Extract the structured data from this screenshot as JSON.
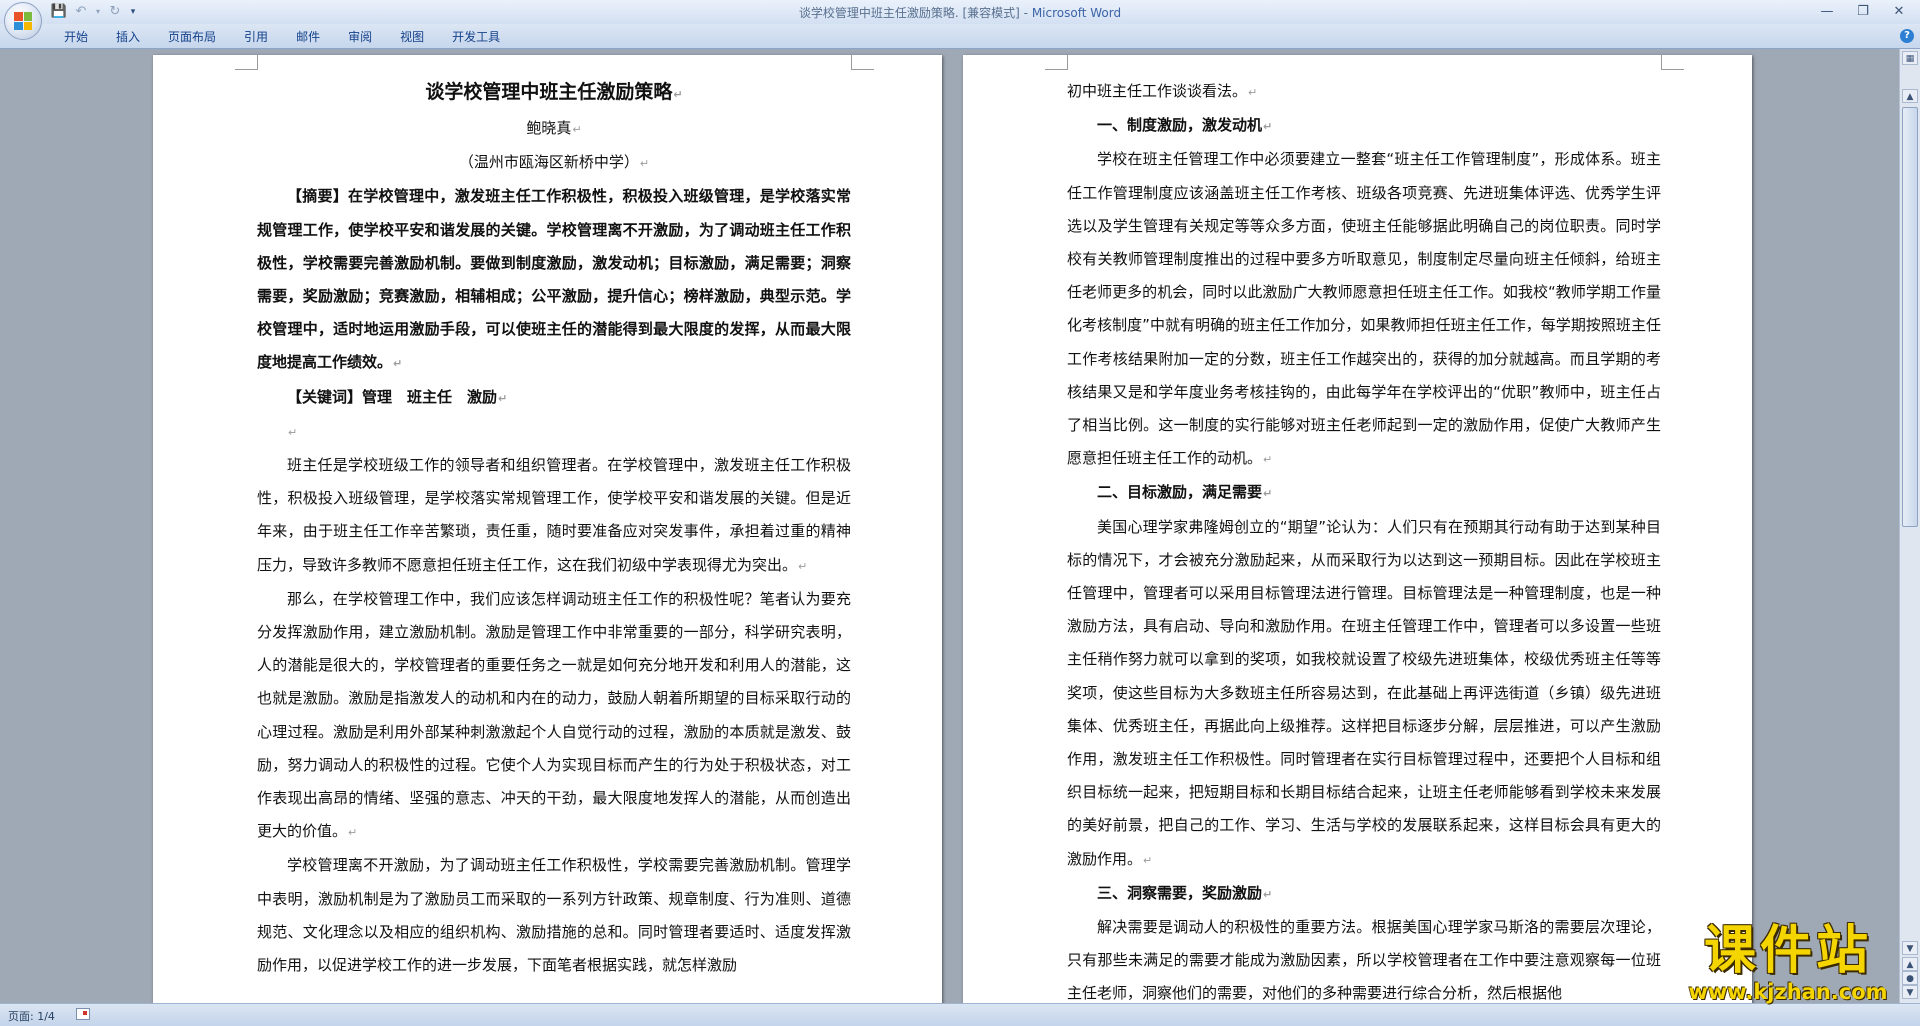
{
  "window": {
    "title_doc": "谈学校管理中班主任激励策略. [兼容模式] - ",
    "title_app": "Microsoft Word"
  },
  "ribbon": {
    "tabs": [
      "开始",
      "插入",
      "页面布局",
      "引用",
      "邮件",
      "审阅",
      "视图",
      "开发工具"
    ]
  },
  "status": {
    "page": "页面: 1/4"
  },
  "watermark": {
    "main": "课件站",
    "url": "www.kjzhan.com"
  },
  "page1": {
    "title": "谈学校管理中班主任激励策略",
    "author": "鲍晓真",
    "affiliation": "（温州市瓯海区新桥中学）",
    "abstract_label": "【摘要】",
    "abstract": "在学校管理中，激发班主任工作积极性，积极投入班级管理，是学校落实常规管理工作，使学校平安和谐发展的关键。学校管理离不开激励，为了调动班主任工作积极性，学校需要完善激励机制。要做到制度激励，激发动机；目标激励，满足需要；洞察需要，奖励激励；竞赛激励，相辅相成；公平激励，提升信心；榜样激励，典型示范。学校管理中，适时地运用激励手段，可以使班主任的潜能得到最大限度的发挥，从而最大限度地提高工作绩效。",
    "keywords_label": "【关键词】",
    "keywords": "管理　班主任　激励",
    "para1": "班主任是学校班级工作的领导者和组织管理者。在学校管理中，激发班主任工作积极性，积极投入班级管理，是学校落实常规管理工作，使学校平安和谐发展的关键。但是近年来，由于班主任工作辛苦繁琐，责任重，随时要准备应对突发事件，承担着过重的精神压力，导致许多教师不愿意担任班主任工作，这在我们初级中学表现得尤为突出。",
    "para2": "那么，在学校管理工作中，我们应该怎样调动班主任工作的积极性呢？笔者认为要充分发挥激励作用，建立激励机制。激励是管理工作中非常重要的一部分，科学研究表明，人的潜能是很大的，学校管理者的重要任务之一就是如何充分地开发和利用人的潜能，这也就是激励。激励是指激发人的动机和内在的动力，鼓励人朝着所期望的目标采取行动的心理过程。激励是利用外部某种刺激激起个人自觉行动的过程，激励的本质就是激发、鼓励，努力调动人的积极性的过程。它使个人为实现目标而产生的行为处于积极状态，对工作表现出高昂的情绪、坚强的意志、冲天的干劲，最大限度地发挥人的潜能，从而创造出更大的价值。",
    "para3": "学校管理离不开激励，为了调动班主任工作积极性，学校需要完善激励机制。管理学中表明，激励机制是为了激励员工而采取的一系列方针政策、规章制度、行为准则、道德规范、文化理念以及相应的组织机构、激励措施的总和。同时管理者要适时、适度发挥激励作用，以促进学校工作的进一步发展，下面笔者根据实践，就怎样激励"
  },
  "page2": {
    "cont": "初中班主任工作谈谈看法。",
    "h1": "一、制度激励，激发动机",
    "p1": "学校在班主任管理工作中必须要建立一整套“班主任工作管理制度”，形成体系。班主任工作管理制度应该涵盖班主任工作考核、班级各项竞赛、先进班集体评选、优秀学生评选以及学生管理有关规定等等众多方面，使班主任能够据此明确自己的岗位职责。同时学校有关教师管理制度推出的过程中要多方听取意见，制度制定尽量向班主任倾斜，给班主任老师更多的机会，同时以此激励广大教师愿意担任班主任工作。如我校“教师学期工作量化考核制度”中就有明确的班主任工作加分，如果教师担任班主任工作，每学期按照班主任工作考核结果附加一定的分数，班主任工作越突出的，获得的加分就越高。而且学期的考核结果又是和学年度业务考核挂钩的，由此每学年在学校评出的“优职”教师中，班主任占了相当比例。这一制度的实行能够对班主任老师起到一定的激励作用，促使广大教师产生愿意担任班主任工作的动机。",
    "h2": "二、目标激励，满足需要",
    "p2": "美国心理学家弗隆姆创立的“期望”论认为：人们只有在预期其行动有助于达到某种目标的情况下，才会被充分激励起来，从而采取行为以达到这一预期目标。因此在学校班主任管理中，管理者可以采用目标管理法进行管理。目标管理法是一种管理制度，也是一种激励方法，具有启动、导向和激励作用。在班主任管理工作中，管理者可以多设置一些班主任稍作努力就可以拿到的奖项，如我校就设置了校级先进班集体，校级优秀班主任等等奖项，使这些目标为大多数班主任所容易达到，在此基础上再评选街道（乡镇）级先进班集体、优秀班主任，再据此向上级推荐。这样把目标逐步分解，层层推进，可以产生激励作用，激发班主任工作积极性。同时管理者在实行目标管理过程中，还要把个人目标和组织目标统一起来，把短期目标和长期目标结合起来，让班主任老师能够看到学校未来发展的美好前景，把自己的工作、学习、生活与学校的发展联系起来，这样目标会具有更大的激励作用。",
    "h3": "三、洞察需要，奖励激励",
    "p3": "解决需要是调动人的积极性的重要方法。根据美国心理学家马斯洛的需要层次理论，只有那些未满足的需要才能成为激励因素，所以学校管理者在工作中要注意观察每一位班主任老师，洞察他们的需要，对他们的多种需要进行综合分析，然后根据他"
  }
}
